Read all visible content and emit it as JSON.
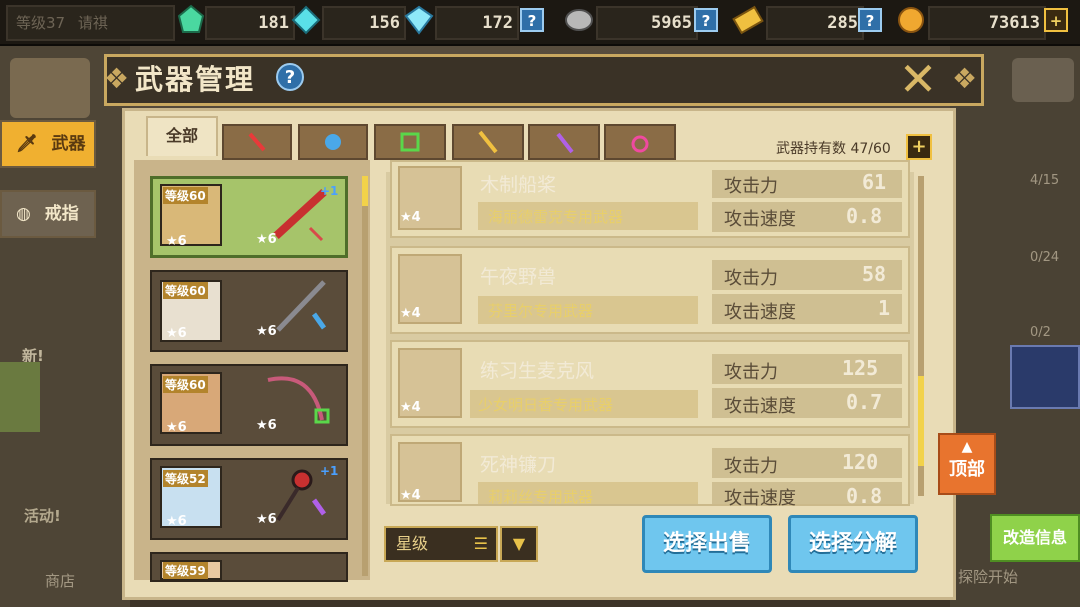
{
  "topbar": {
    "level_label": "等级37",
    "level_name": "请祺",
    "resources": [
      {
        "icon": "green-gem-icon",
        "value": "181"
      },
      {
        "icon": "cyan-gem-icon",
        "value": "156"
      },
      {
        "icon": "diamond-icon",
        "value": "172"
      },
      {
        "icon": "stone-icon",
        "value": "5965"
      },
      {
        "icon": "ticket-icon",
        "value": "285"
      },
      {
        "icon": "gold-coin-icon",
        "value": "73613"
      }
    ],
    "help": "?",
    "plus": "+"
  },
  "header": {
    "title": "武器管理",
    "help": "?",
    "close": "✕"
  },
  "tabs": [
    {
      "label": "全部",
      "active": true
    },
    {
      "icon": "sword-tab-icon"
    },
    {
      "icon": "glove-tab-icon"
    },
    {
      "icon": "frame-tab-icon"
    },
    {
      "icon": "staff-tab-icon"
    },
    {
      "icon": "wand-tab-icon"
    },
    {
      "icon": "amulet-tab-icon"
    }
  ],
  "weapon_count": "武器持有数 47/60",
  "add": "+",
  "side_menu": [
    {
      "label": "武器",
      "active": true
    },
    {
      "label": "戒指",
      "active": false
    }
  ],
  "hero_cards": [
    {
      "level": "等级60",
      "star": "6",
      "weapon_star": "6",
      "bonus": "+1"
    },
    {
      "level": "等级60",
      "star": "6",
      "weapon_star": "6",
      "bonus": ""
    },
    {
      "level": "等级60",
      "star": "6",
      "weapon_star": "6",
      "bonus": ""
    },
    {
      "level": "等级52",
      "star": "6",
      "weapon_star": "6",
      "bonus": "+1"
    },
    {
      "level": "等级59",
      "star": "",
      "weapon_star": "",
      "bonus": ""
    }
  ],
  "weapons": [
    {
      "name": "木制船桨",
      "owner": "海丽德雷克专用武器",
      "atk_label": "攻击力",
      "atk": "61",
      "spd_label": "攻击速度",
      "spd": "0.8",
      "star": "4"
    },
    {
      "name": "午夜野兽",
      "owner": "芬里尔专用武器",
      "atk_label": "攻击力",
      "atk": "58",
      "spd_label": "攻击速度",
      "spd": "1",
      "star": "4"
    },
    {
      "name": "练习生麦克风",
      "owner": "少女明日香专用武器",
      "atk_label": "攻击力",
      "atk": "125",
      "spd_label": "攻击速度",
      "spd": "0.7",
      "star": "4"
    },
    {
      "name": "死神镰刀",
      "owner": "莉莉丝专用武器",
      "atk_label": "攻击力",
      "atk": "120",
      "spd_label": "攻击速度",
      "spd": "0.8",
      "star": "4"
    }
  ],
  "sort": {
    "label": "星级",
    "list_icon": "☰",
    "arrow": "▼"
  },
  "buttons": {
    "sell": "选择出售",
    "dismantle": "选择分解",
    "top": "顶部",
    "modify": "改造信息"
  },
  "background": {
    "new": "新!",
    "event": "活动!",
    "shop": "商店",
    "adventure": "探险开始",
    "progress1": "4/15",
    "progress2": "0/24",
    "progress3": "0/2"
  }
}
